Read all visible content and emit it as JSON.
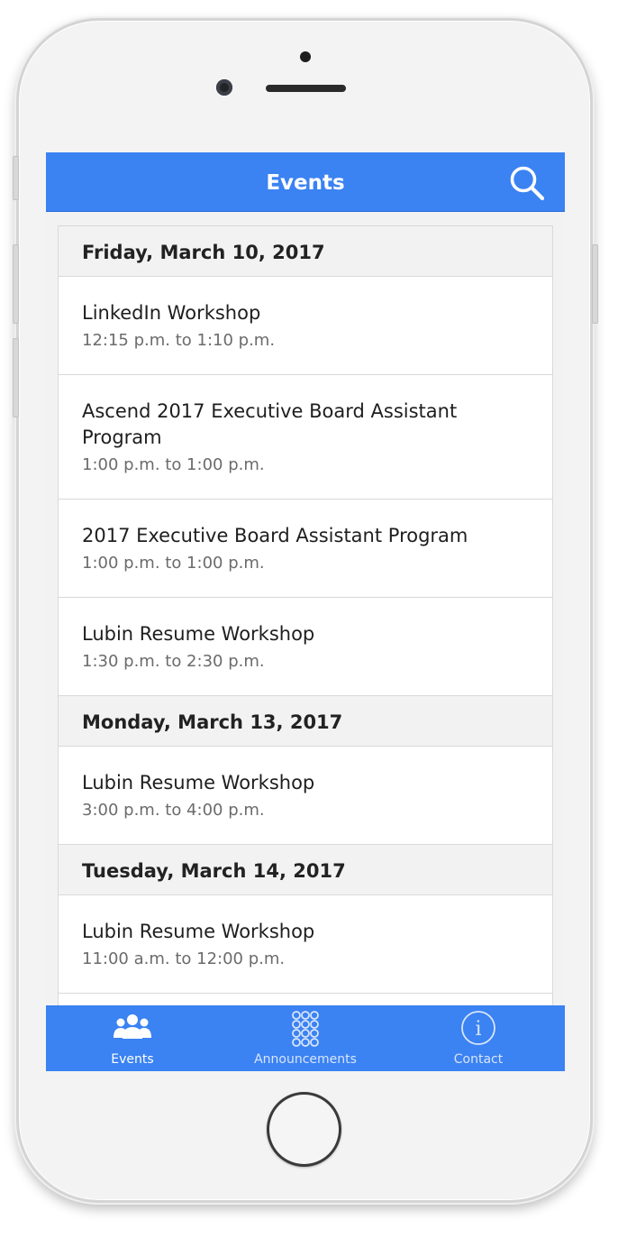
{
  "header": {
    "title": "Events",
    "search_icon": "search-icon"
  },
  "days": [
    {
      "date": "Friday, March 10, 2017",
      "events": [
        {
          "title": "LinkedIn Workshop",
          "time": "12:15 p.m. to 1:10 p.m."
        },
        {
          "title": "Ascend 2017 Executive Board Assistant Program",
          "time": "1:00 p.m. to 1:00 p.m."
        },
        {
          "title": "2017 Executive Board Assistant Program",
          "time": "1:00 p.m. to 1:00 p.m."
        },
        {
          "title": "Lubin Resume Workshop",
          "time": "1:30 p.m. to 2:30 p.m."
        }
      ]
    },
    {
      "date": "Monday, March 13, 2017",
      "events": [
        {
          "title": "Lubin Resume Workshop",
          "time": "3:00 p.m. to 4:00 p.m."
        }
      ]
    },
    {
      "date": "Tuesday, March 14, 2017",
      "events": [
        {
          "title": "Lubin Resume Workshop",
          "time": "11:00 a.m. to 12:00 p.m."
        }
      ]
    }
  ],
  "tabs": [
    {
      "label": "Events",
      "icon": "people-icon",
      "active": true
    },
    {
      "label": "Announcements",
      "icon": "grid-icon",
      "active": false
    },
    {
      "label": "Contact",
      "icon": "info-icon",
      "active": false
    }
  ],
  "colors": {
    "accent": "#3b82f2",
    "background": "#f2f2f2"
  }
}
